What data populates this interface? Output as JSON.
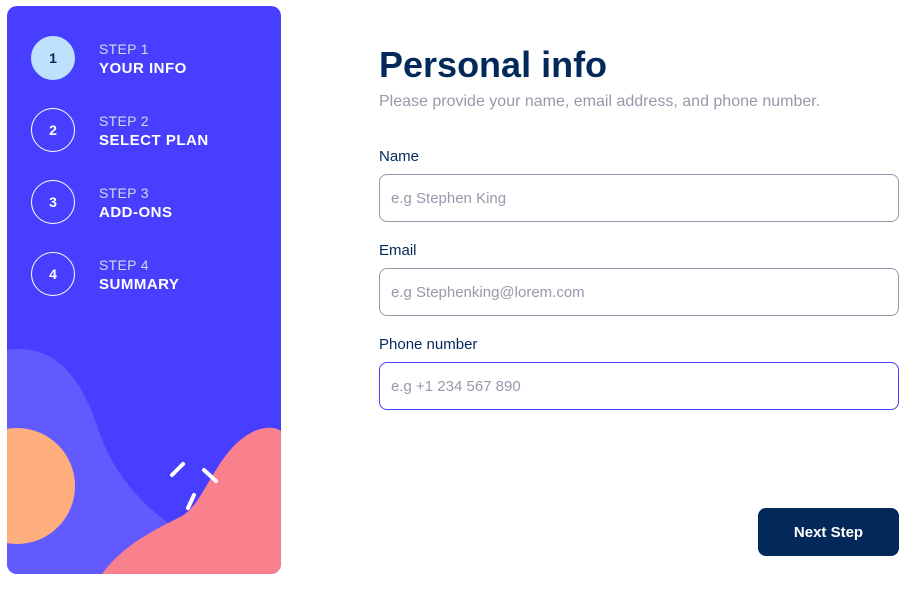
{
  "sidebar": {
    "steps": [
      {
        "number": "1",
        "step_label": "STEP 1",
        "name": "YOUR INFO",
        "active": true
      },
      {
        "number": "2",
        "step_label": "STEP 2",
        "name": "SELECT PLAN",
        "active": false
      },
      {
        "number": "3",
        "step_label": "STEP 3",
        "name": "ADD-ONS",
        "active": false
      },
      {
        "number": "4",
        "step_label": "STEP 4",
        "name": "SUMMARY",
        "active": false
      }
    ]
  },
  "form": {
    "title": "Personal info",
    "subtitle": "Please provide your name, email address, and phone number.",
    "fields": {
      "name": {
        "label": "Name",
        "placeholder": "e.g Stephen King",
        "value": ""
      },
      "email": {
        "label": "Email",
        "placeholder": "e.g Stephenking@lorem.com",
        "value": ""
      },
      "phone": {
        "label": "Phone number",
        "placeholder": "e.g +1 234 567 890",
        "value": "",
        "focused": true
      }
    },
    "next_label": "Next Step"
  },
  "colors": {
    "sidebar_bg": "#483eff",
    "active_step_bg": "#bee2fd",
    "marine_blue": "#02295a",
    "cool_gray": "#9699ab",
    "focus_border": "#473dff",
    "decor_wave": "#6259ff",
    "decor_circle": "#ffaf7e",
    "decor_blob": "#f9818e"
  }
}
